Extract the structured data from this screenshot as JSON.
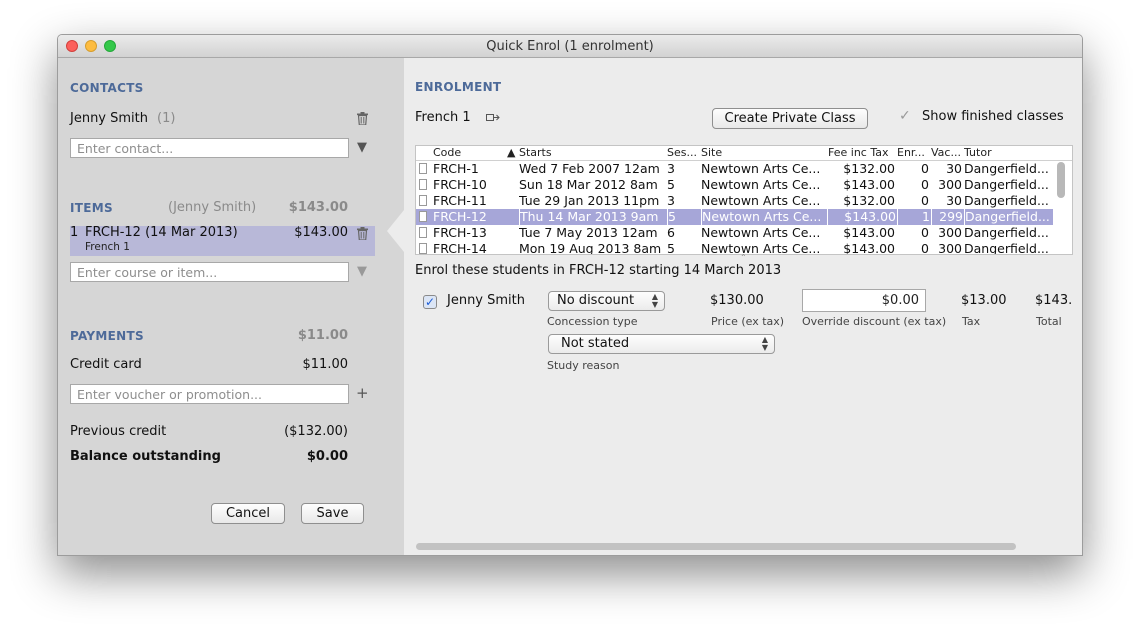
{
  "window": {
    "title": "Quick Enrol (1 enrolment)"
  },
  "contacts": {
    "heading": "CONTACTS",
    "name": "Jenny Smith",
    "count": "(1)",
    "placeholder": "Enter contact..."
  },
  "items": {
    "heading": "ITEMS",
    "contact": "(Jenny Smith)",
    "total": "$143.00",
    "item_index": "1",
    "item_name": "FRCH-12 (14 Mar 2013)",
    "item_sub": "French 1",
    "item_price": "$143.00",
    "placeholder": "Enter course or item..."
  },
  "payments": {
    "heading": "PAYMENTS",
    "total": "$11.00",
    "method_label": "Credit card",
    "method_amount": "$11.00",
    "placeholder": "Enter voucher or promotion...",
    "previous_credit_label": "Previous credit",
    "previous_credit_value": "($132.00)",
    "balance_label": "Balance outstanding",
    "balance_value": "$0.00"
  },
  "buttons": {
    "cancel": "Cancel",
    "save": "Save",
    "create_private": "Create Private Class"
  },
  "enrolment": {
    "heading": "ENROLMENT",
    "course": "French 1",
    "show_finished_label": "Show finished classes",
    "show_finished_checked": true,
    "columns": [
      "Code",
      "Starts",
      "Ses...",
      "Site",
      "Fee inc Tax",
      "Enr...",
      "Vac...",
      "Tutor"
    ],
    "rows": [
      [
        "FRCH-1",
        "Wed 7 Feb 2007 12am",
        "3",
        "Newtown Arts Ce...",
        "$132.00",
        "0",
        "30",
        "Dangerfield..."
      ],
      [
        "FRCH-10",
        "Sun 18 Mar 2012 8am",
        "5",
        "Newtown Arts Ce...",
        "$143.00",
        "0",
        "300",
        "Dangerfield..."
      ],
      [
        "FRCH-11",
        "Tue 29 Jan 2013 11pm",
        "3",
        "Newtown Arts Ce...",
        "$132.00",
        "0",
        "30",
        "Dangerfield..."
      ],
      [
        "FRCH-12",
        "Thu 14 Mar 2013 9am",
        "5",
        "Newtown Arts Ce...",
        "$143.00",
        "1",
        "299",
        "Dangerfield..."
      ],
      [
        "FRCH-13",
        "Tue 7 May 2013 12am",
        "6",
        "Newtown Arts Ce...",
        "$143.00",
        "0",
        "300",
        "Dangerfield..."
      ],
      [
        "FRCH-14",
        "Mon 19 Aug 2013 8am",
        "5",
        "Newtown Arts Ce...",
        "$143.00",
        "0",
        "300",
        "Dangerfield..."
      ]
    ],
    "selected_row": 3,
    "enrol_text": "Enrol these students in FRCH-12 starting 14 March 2013",
    "student": {
      "name": "Jenny Smith",
      "checked": true,
      "concession": "No discount",
      "concession_label": "Concession type",
      "price": "$130.00",
      "price_label": "Price (ex tax)",
      "override": "$0.00",
      "override_label": "Override discount (ex tax)",
      "tax": "$13.00",
      "tax_label": "Tax",
      "total": "$143.",
      "total_label": "Total",
      "study_reason": "Not stated",
      "study_reason_label": "Study reason"
    }
  }
}
